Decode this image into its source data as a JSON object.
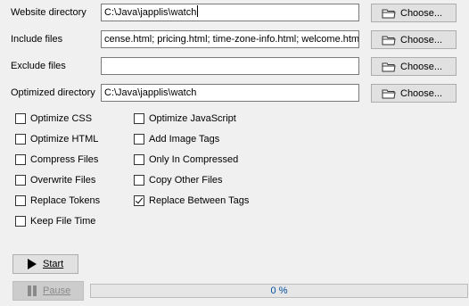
{
  "fields": [
    {
      "label": "Website directory",
      "value": "C:\\Java\\japplis\\watch",
      "button": "Choose..."
    },
    {
      "label": "Include files",
      "value": "cense.html; pricing.html; time-zone-info.html; welcome.html",
      "button": "Choose..."
    },
    {
      "label": "Exclude files",
      "value": "",
      "button": "Choose..."
    },
    {
      "label": "Optimized directory",
      "value": "C:\\Java\\japplis\\watch",
      "button": "Choose..."
    }
  ],
  "options_left": [
    {
      "label": "Optimize CSS",
      "checked": false
    },
    {
      "label": "Optimize HTML",
      "checked": false
    },
    {
      "label": "Compress Files",
      "checked": false
    },
    {
      "label": "Overwrite Files",
      "checked": false
    },
    {
      "label": "Replace Tokens",
      "checked": false
    },
    {
      "label": "Keep File Time",
      "checked": false
    }
  ],
  "options_right": [
    {
      "label": "Optimize JavaScript",
      "checked": false
    },
    {
      "label": "Add Image Tags",
      "checked": false
    },
    {
      "label": "Only In Compressed",
      "checked": false
    },
    {
      "label": "Copy Other Files",
      "checked": false
    },
    {
      "label": "Replace Between Tags",
      "checked": true
    }
  ],
  "actions": {
    "start_label": "Start",
    "pause_label": "Pause",
    "pause_enabled": false
  },
  "progress": {
    "percent": 0,
    "text": "0 %"
  },
  "colors": {
    "window_bg": "#f0f0f0",
    "button_bg": "#e1e1e1",
    "progress_text": "#0050a0",
    "progress_fill": "#06b025"
  }
}
